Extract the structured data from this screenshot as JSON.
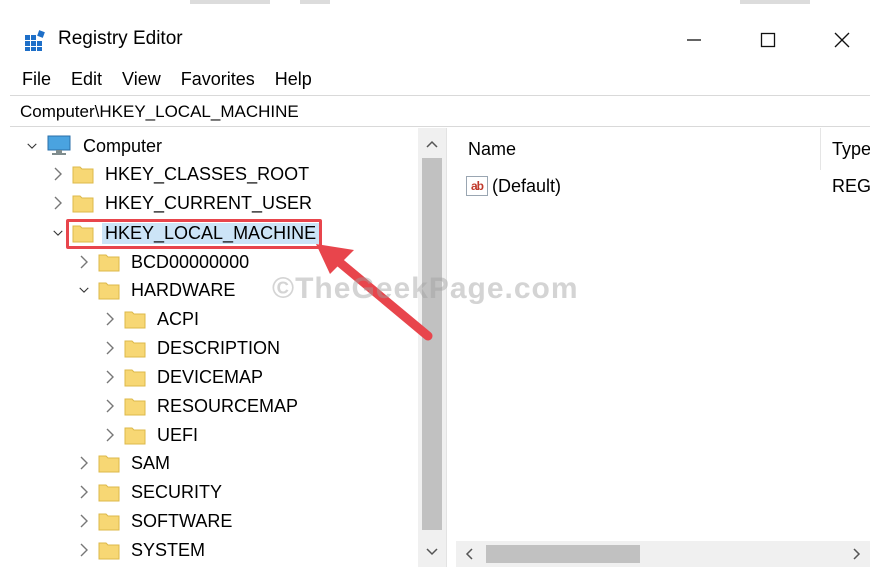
{
  "window": {
    "title": "Registry Editor",
    "controls": {
      "minimize": "—",
      "maximize": "☐",
      "close": "✕"
    }
  },
  "menu": [
    "File",
    "Edit",
    "View",
    "Favorites",
    "Help"
  ],
  "address": {
    "path": "Computer\\HKEY_LOCAL_MACHINE"
  },
  "tree": {
    "root": "Computer",
    "hives": [
      "HKEY_CLASSES_ROOT",
      "HKEY_CURRENT_USER",
      "HKEY_LOCAL_MACHINE"
    ],
    "hklm_children": [
      "BCD00000000",
      "HARDWARE"
    ],
    "hardware_children": [
      "ACPI",
      "DESCRIPTION",
      "DEVICEMAP",
      "RESOURCEMAP",
      "UEFI"
    ],
    "hklm_more": [
      "SAM",
      "SECURITY",
      "SOFTWARE",
      "SYSTEM"
    ],
    "selected": "HKEY_LOCAL_MACHINE"
  },
  "values": {
    "columns": {
      "name": "Name",
      "type": "Type"
    },
    "rows": [
      {
        "name": "(Default)",
        "type": "REG_"
      }
    ]
  },
  "watermark": "©TheGeekPage.com",
  "colors": {
    "selection": "#cce4f7",
    "highlight_box": "#e8454c",
    "folder": "#f7d774"
  }
}
